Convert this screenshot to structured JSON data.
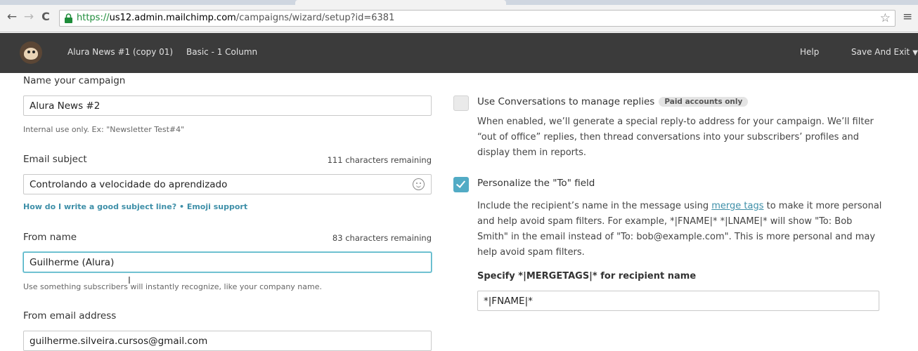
{
  "browser": {
    "url_scheme": "https://",
    "url_host": "us12.admin.mailchimp.com",
    "url_path": "/campaigns/wizard/setup?id=6381"
  },
  "header": {
    "campaign_name": "Alura News #1 (copy 01)",
    "template_name": "Basic - 1 Column",
    "help_label": "Help",
    "save_exit_label": "Save And Exit"
  },
  "form": {
    "campaign_name": {
      "label": "Name your campaign",
      "value": "Alura News #2",
      "hint": "Internal use only. Ex: \"Newsletter Test#4\""
    },
    "email_subject": {
      "label": "Email subject",
      "remaining": "111 characters remaining",
      "value": "Controlando a velocidade do aprendizado",
      "help_link": "How do I write a good subject line?",
      "separator": "•",
      "emoji_link": "Emoji support"
    },
    "from_name": {
      "label": "From name",
      "remaining": "83 characters remaining",
      "value": "Guilherme (Alura)",
      "hint": "Use something subscribers will instantly recognize, like your company name."
    },
    "from_email": {
      "label": "From email address",
      "value": "guilherme.silveira.cursos@gmail.com"
    }
  },
  "options": {
    "conversations": {
      "title": "Use Conversations to manage replies",
      "badge": "Paid accounts only",
      "checked": false,
      "description": "When enabled, we’ll generate a special reply-to address for your campaign. We’ll filter “out of office” replies, then thread conversations into your subscribers’ profiles and display them in reports."
    },
    "personalize": {
      "title": "Personalize the \"To\" field",
      "checked": true,
      "desc_before": "Include the recipient’s name in the message using ",
      "desc_link": "merge tags",
      "desc_after": " to make it more personal and help avoid spam filters. For example, *|FNAME|* *|LNAME|* will show \"To: Bob Smith\" in the email instead of \"To: bob@example.com\". This is more personal and may help avoid spam filters.",
      "merge_label": "Specify *|MERGETAGS|* for recipient name",
      "merge_value": "*|FNAME|*"
    }
  },
  "colors": {
    "header_bg": "#3b3b3b",
    "accent": "#52abc5",
    "link": "#3e8fa8"
  }
}
